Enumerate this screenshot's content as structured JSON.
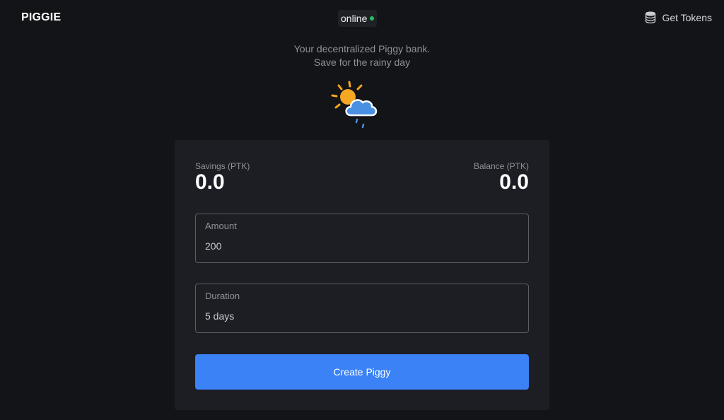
{
  "header": {
    "brand": "PIGGIE",
    "status_text": "online",
    "status_color": "#22c55e",
    "get_tokens_label": "Get Tokens",
    "get_tokens_icon": "coins-stack-icon"
  },
  "tagline": {
    "line1": "Your decentralized Piggy bank.",
    "line2": "Save for the rainy day"
  },
  "illustration": "sun-behind-rain-cloud-icon",
  "card": {
    "savings_label": "Savings (PTK)",
    "savings_value": "0.0",
    "balance_label": "Balance (PTK)",
    "balance_value": "0.0",
    "amount_label": "Amount",
    "amount_value": "200",
    "duration_label": "Duration",
    "duration_value": "5 days",
    "create_button_label": "Create Piggy",
    "accent_color": "#3b82f6"
  }
}
